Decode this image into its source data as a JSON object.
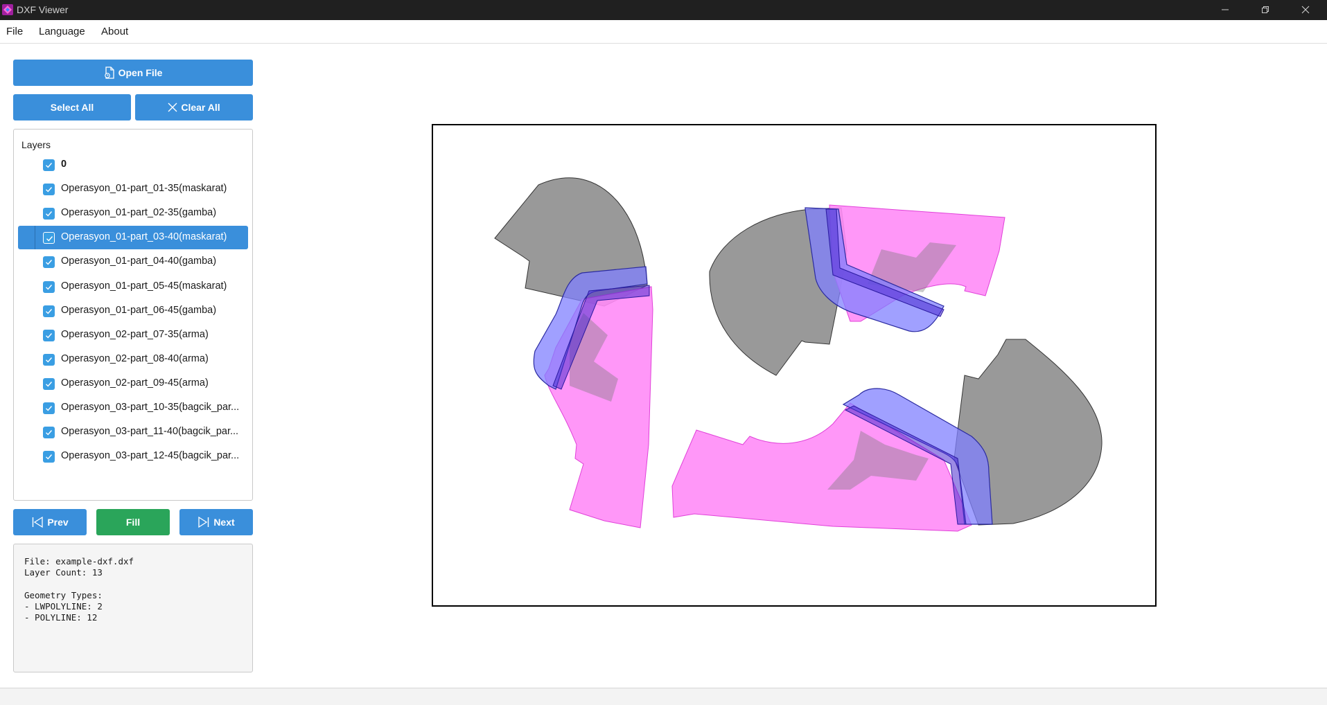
{
  "window": {
    "title": "DXF Viewer"
  },
  "menu": {
    "file": "File",
    "language": "Language",
    "about": "About"
  },
  "toolbar": {
    "open_file": "Open File",
    "select_all": "Select All",
    "clear_all": "Clear All"
  },
  "layers": {
    "title": "Layers",
    "items": [
      {
        "label": "0",
        "checked": true
      },
      {
        "label": "Operasyon_01-part_01-35(maskarat)",
        "checked": true
      },
      {
        "label": "Operasyon_01-part_02-35(gamba)",
        "checked": true
      },
      {
        "label": "Operasyon_01-part_03-40(maskarat)",
        "checked": true,
        "selected": true
      },
      {
        "label": "Operasyon_01-part_04-40(gamba)",
        "checked": true
      },
      {
        "label": "Operasyon_01-part_05-45(maskarat)",
        "checked": true
      },
      {
        "label": "Operasyon_01-part_06-45(gamba)",
        "checked": true
      },
      {
        "label": "Operasyon_02-part_07-35(arma)",
        "checked": true
      },
      {
        "label": "Operasyon_02-part_08-40(arma)",
        "checked": true
      },
      {
        "label": "Operasyon_02-part_09-45(arma)",
        "checked": true
      },
      {
        "label": "Operasyon_03-part_10-35(bagcik_par...",
        "checked": true
      },
      {
        "label": "Operasyon_03-part_11-40(bagcik_par...",
        "checked": true
      },
      {
        "label": "Operasyon_03-part_12-45(bagcik_par...",
        "checked": true
      }
    ]
  },
  "nav": {
    "prev": "Prev",
    "fill": "Fill",
    "next": "Next"
  },
  "info": {
    "file": "File: example-dxf.dxf",
    "layer_count": "Layer Count: 13",
    "geometry_title": "Geometry Types:",
    "lwpolyline": "- LWPOLYLINE: 2",
    "polyline": "- POLYLINE: 12"
  },
  "colors": {
    "accent": "#3a8fdb",
    "fill_button": "#2aa55a",
    "shape_gray": "#999999",
    "shape_pink": "#ff8cf7",
    "shape_blue": "#8080ff",
    "titlebar": "#202020"
  },
  "icons": {
    "open_file": "file-icon",
    "clear_all": "close-icon",
    "prev": "skip-back-icon",
    "next": "skip-forward-icon",
    "checkbox": "checkmark-icon"
  }
}
